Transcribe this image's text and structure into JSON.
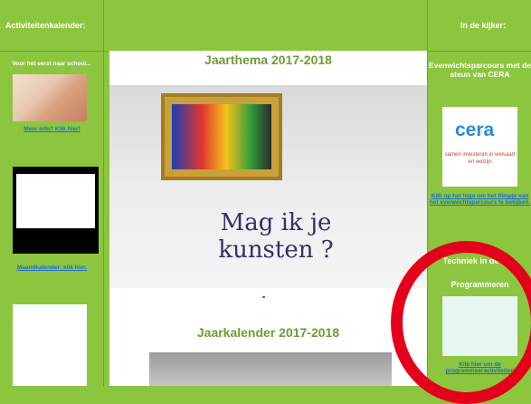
{
  "left": {
    "header": "Activiteitenkalender:",
    "section_title": "Voor het eerst naar school...",
    "link_1": "Meer info? Klik hier!",
    "link_2": "Maandkalender: klik hier."
  },
  "middle": {
    "title_1": "Jaarthema 2017-2018",
    "tagline": "Mag ik je kunsten ?",
    "title_2": "Jaarkalender 2017-2018"
  },
  "right": {
    "header": "In de kijker:",
    "section_1_title": "Evenwichtsparcours met de steun van CERA",
    "cera_logo": "cera",
    "cera_text": "samen investeren in welvaart en welzijn",
    "cera_link": "Klik op het logo om het filmpje van het evenwichtsparcours te bekijken.",
    "section_2_title": "Techniek in de klas",
    "section_2_sub": "Programmeren",
    "prog_link": "Klik hier om de programmeeractiviteiten"
  },
  "colors": {
    "background": "#8cc63f",
    "title_green": "#6a9e33",
    "link_blue": "#1c6dd0",
    "highlight_red": "#e4001b"
  }
}
